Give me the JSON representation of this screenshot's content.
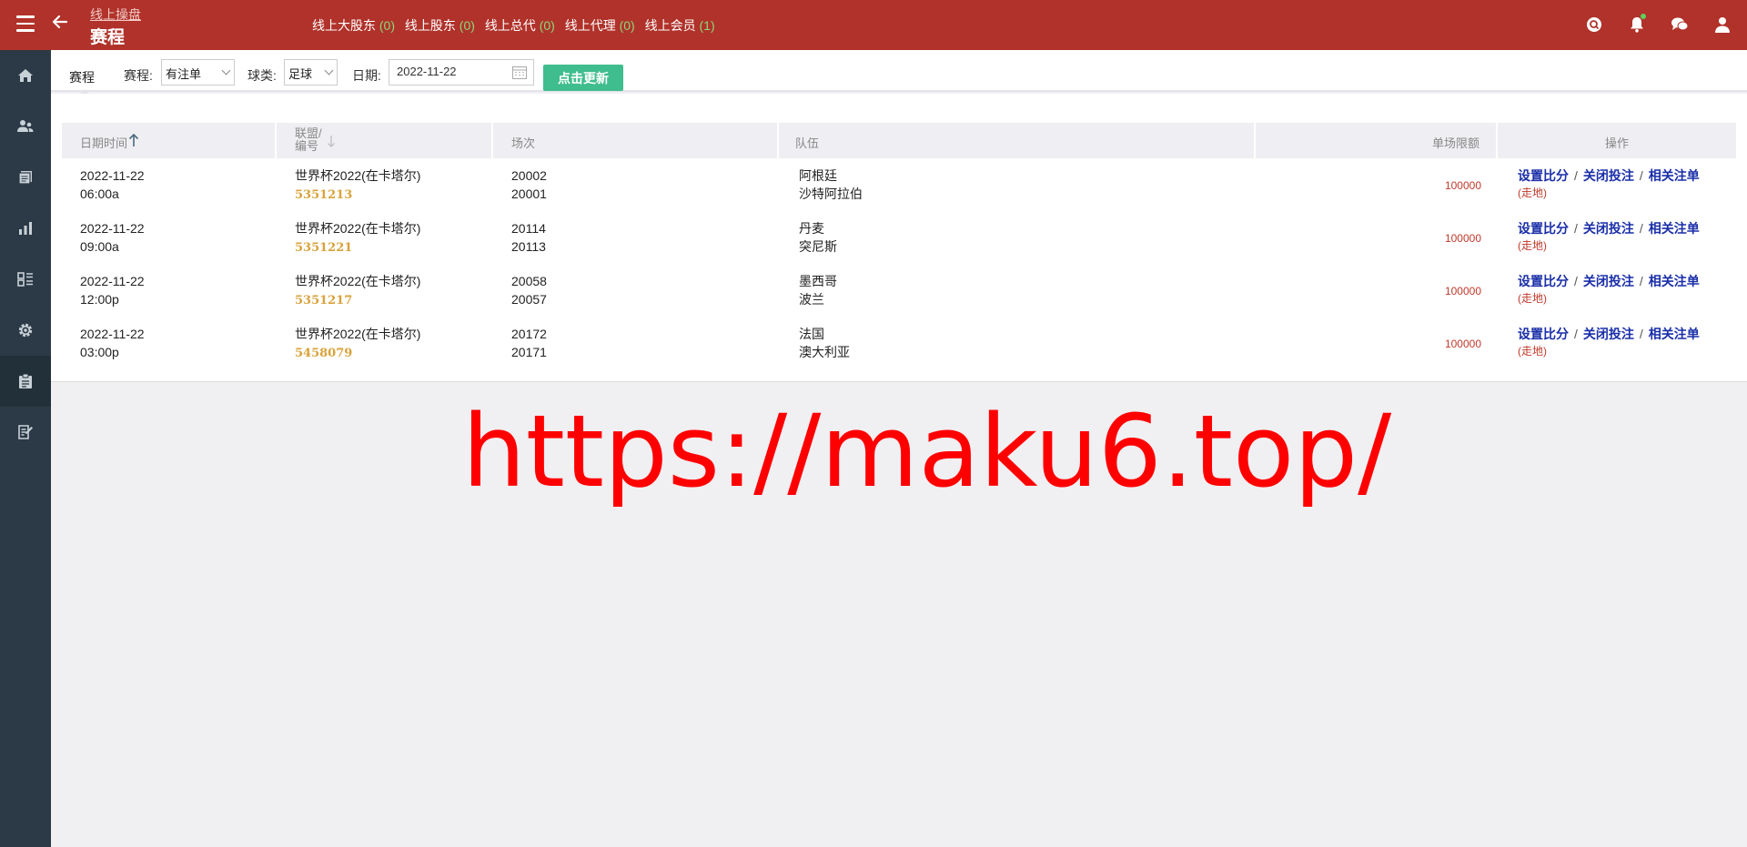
{
  "header": {
    "breadcrumb": "线上操盘",
    "title": "赛程",
    "online": [
      {
        "label": "线上大股东",
        "count": "(0)"
      },
      {
        "label": "线上股东",
        "count": "(0)"
      },
      {
        "label": "线上总代",
        "count": "(0)"
      },
      {
        "label": "线上代理",
        "count": "(0)"
      },
      {
        "label": "线上会员",
        "count": "(1)"
      }
    ],
    "icons": [
      "search-icon",
      "bell-icon",
      "chat-icon",
      "user-icon"
    ]
  },
  "sidebar": {
    "items": [
      "home-icon",
      "users-icon",
      "documents-icon",
      "chart-icon",
      "list-icon",
      "settings-icon",
      "clipboard-icon",
      "report-icon"
    ],
    "active_index": 6
  },
  "filters": {
    "tab": "赛程",
    "schedule_label": "赛程:",
    "schedule_value": "有注单",
    "sport_label": "球类:",
    "sport_value": "足球",
    "date_label": "日期:",
    "date_value": "2022-11-22",
    "refresh_label": "点击更新"
  },
  "table": {
    "headers": {
      "datetime": "日期时间",
      "league_line1": "联盟/",
      "league_line2": "编号",
      "match": "场次",
      "teams": "队伍",
      "limit": "单场限额",
      "ops": "操作"
    },
    "rows": [
      {
        "date": "2022-11-22",
        "time": "06:00a",
        "league": "世界杯2022(在卡塔尔)",
        "code": "5351213",
        "match1": "20002",
        "match2": "20001",
        "team1": "阿根廷",
        "team2": "沙特阿拉伯",
        "limit": "100000"
      },
      {
        "date": "2022-11-22",
        "time": "09:00a",
        "league": "世界杯2022(在卡塔尔)",
        "code": "5351221",
        "match1": "20114",
        "match2": "20113",
        "team1": "丹麦",
        "team2": "突尼斯",
        "limit": "100000"
      },
      {
        "date": "2022-11-22",
        "time": "12:00p",
        "league": "世界杯2022(在卡塔尔)",
        "code": "5351217",
        "match1": "20058",
        "match2": "20057",
        "team1": "墨西哥",
        "team2": "波兰",
        "limit": "100000"
      },
      {
        "date": "2022-11-22",
        "time": "03:00p",
        "league": "世界杯2022(在卡塔尔)",
        "code": "5458079",
        "match1": "20172",
        "match2": "20171",
        "team1": "法国",
        "team2": "澳大利亚",
        "limit": "100000"
      }
    ],
    "ops": {
      "set_score": "设置比分",
      "close_bet": "关闭投注",
      "related_bets": "相关注单",
      "separator": "/",
      "tag": "(走地)"
    }
  },
  "watermark": "https://maku6.top/",
  "colors": {
    "topbar": "#b0322a",
    "sidebar": "#2b3a46",
    "accent_button": "#3fbd8e",
    "code": "#d9a23a",
    "link": "#1a2ea8",
    "limit": "#c0392b"
  }
}
